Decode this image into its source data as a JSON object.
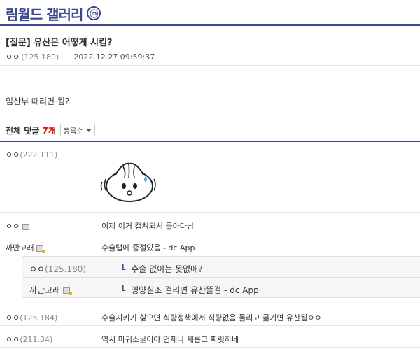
{
  "gallery": {
    "title": "림월드 갤러리",
    "badge": "ⓜ"
  },
  "post": {
    "title": "[질문] 유산은 어떻게 시킴?",
    "author": "ㅇㅇ",
    "ip": "(125.180)",
    "date": "2022.12.27 09:59:37",
    "body": "임산부 때리면 됨?"
  },
  "comments_header": {
    "label": "전체 댓글",
    "count": "7개",
    "sort": "등록순"
  },
  "comments": [
    {
      "nick": "ㅇㅇ",
      "ip": "(222.111)",
      "text": ""
    },
    {
      "nick": "ㅇㅇ",
      "ip": "",
      "text": "이제 이거 캡쳐되서 돌아다님"
    },
    {
      "nick": "까만고래",
      "ip": "",
      "text": "수술탭에 중절있음 - dc App"
    },
    {
      "nick": "ㅇㅇ",
      "ip": "(125.180)",
      "text": "수술 없이는 못없애?"
    },
    {
      "nick": "까만고래",
      "ip": "",
      "text": "영양실조 걸리면 유산뜰걸 - dc App"
    },
    {
      "nick": "ㅇㅇ",
      "ip": "(125.184)",
      "text": "수술시키기 싫으면 식량정책에서 식량없음 돌리고 굶기면 유산됨ㅇㅇ"
    },
    {
      "nick": "ㅇㅇ",
      "ip": "(211.34)",
      "text": "역시 마귀소굴이야 언제나 새롭고 짜릿하네"
    }
  ]
}
